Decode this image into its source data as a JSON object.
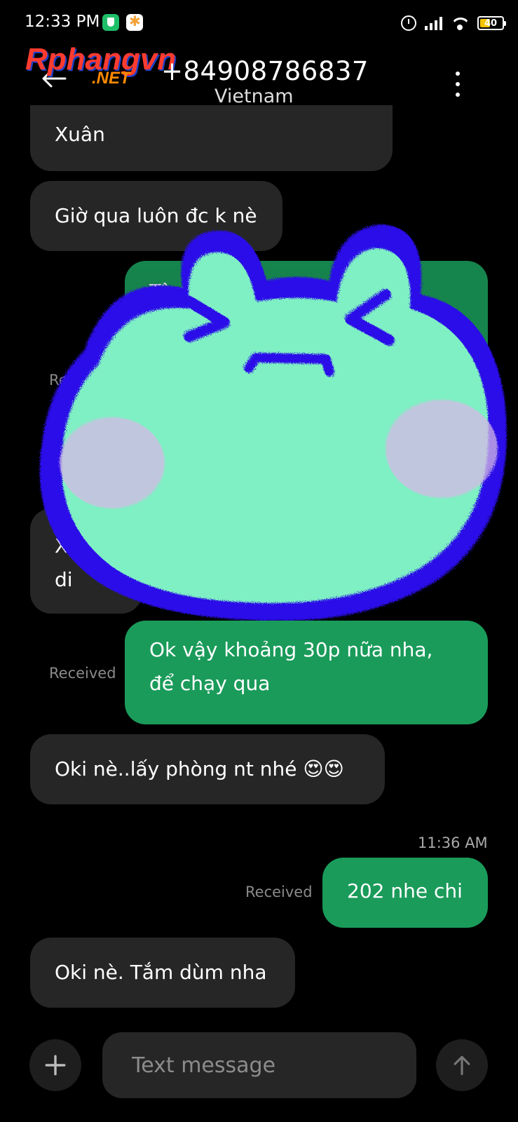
{
  "status_bar": {
    "time": "12:33 PM",
    "battery": "40",
    "icons": [
      "shield-icon",
      "photos-icon",
      "alarm-icon",
      "signal-icon",
      "wifi-icon",
      "battery-icon"
    ]
  },
  "watermark": {
    "line1": "Rphangvn",
    "line2": ".NET"
  },
  "header": {
    "phone": "+84908786837",
    "country": "Vietnam",
    "back_icon": "arrow-left-icon",
    "more_icon": "more-vert-icon"
  },
  "conversation": {
    "received_label": "Received",
    "messages": [
      {
        "direction": "in",
        "text": "Xuân"
      },
      {
        "direction": "in",
        "text": "Giờ qua luôn đc k nè"
      },
      {
        "direction": "out",
        "text": "Tô nhà gần ... Chị",
        "status": "Received",
        "obscured": true
      },
      {
        "direction": "in",
        "text": "Xo... di",
        "obscured": true
      },
      {
        "direction": "out",
        "text": "Ok vậy khoảng 30p nữa nha, để chạy qua",
        "status": "Received"
      },
      {
        "direction": "in",
        "text": "Oki nè..lấy phòng nt nhé 😍😍"
      },
      {
        "direction": "out",
        "text": "202 nhe chi",
        "status": "Received",
        "time": "11:36 AM"
      },
      {
        "direction": "in",
        "text": "Oki nè. Tắm dùm nha"
      }
    ]
  },
  "composer": {
    "placeholder": "Text message",
    "add_icon": "plus-icon",
    "send_icon": "arrow-up-icon"
  },
  "colors": {
    "background": "#000000",
    "incoming_bubble": "#262626",
    "outgoing_bubble": "#1a9b5a",
    "sticker_fill": "#7ff0c4",
    "sticker_outline": "#2a10e8"
  }
}
